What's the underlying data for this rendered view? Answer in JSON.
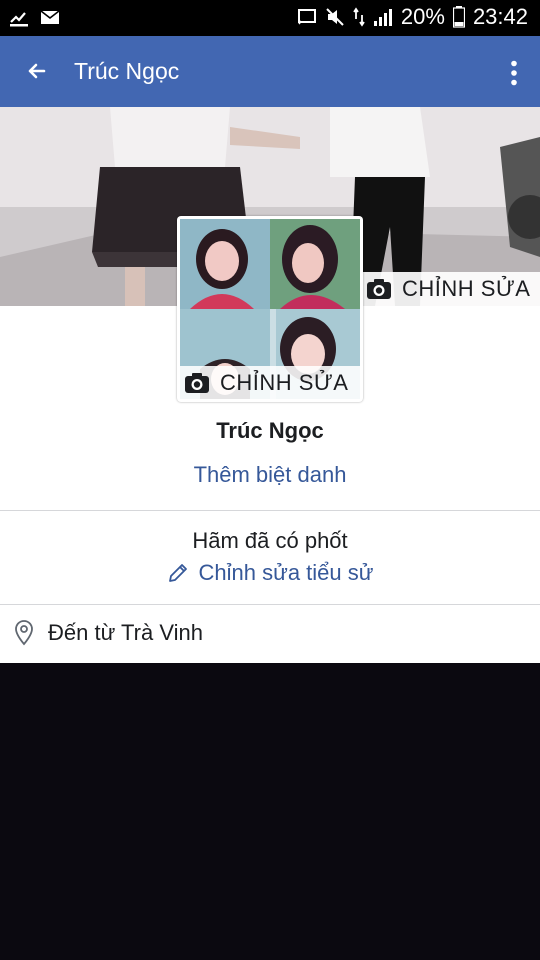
{
  "status_bar": {
    "battery": "20%",
    "time": "23:42",
    "icons": [
      "download-icon",
      "mail-icon",
      "cast-icon",
      "mute-icon",
      "data-transfer-icon",
      "signal-icon",
      "battery-icon"
    ]
  },
  "app_bar": {
    "title": "Trúc Ngọc",
    "back_icon": "arrow-left-icon",
    "menu_icon": "more-vertical-icon",
    "color": "#4267b2"
  },
  "cover": {
    "edit_label": "CHỈNH SỬA"
  },
  "avatar": {
    "edit_label": "CHỈNH SỬA"
  },
  "profile": {
    "name": "Trúc Ngọc",
    "add_nickname": "Thêm biệt danh",
    "bio": "Hãm đã có phốt",
    "edit_bio": "Chỉnh sửa tiểu sử",
    "location": "Đến từ Trà Vinh"
  },
  "colors": {
    "link": "#365899",
    "text": "#1c1e21",
    "background_dark": "#0b0910"
  }
}
